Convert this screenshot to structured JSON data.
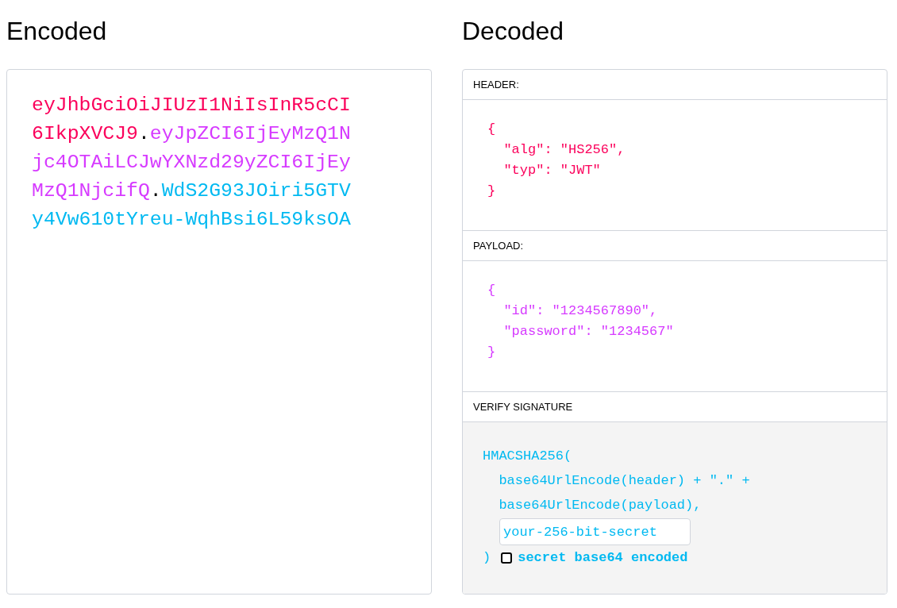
{
  "encoded": {
    "title": "Encoded",
    "segments": [
      {
        "text": "eyJhbGciOiJIUzI1NiIsInR5cCI6IkpXVCJ9",
        "kind": "header"
      },
      {
        "text": ".",
        "kind": "dot"
      },
      {
        "text": "eyJpZCI6IjEyMzQ1Njc4OTAiLCJwYXNzd29yZCI6IjEyMzQ1NjcifQ",
        "kind": "payload"
      },
      {
        "text": ".",
        "kind": "dot"
      },
      {
        "text": "WdS2G93JOiri5GTVy4Vw610tYreu-WqhBsi6L59ksOA",
        "kind": "signature"
      }
    ]
  },
  "decoded": {
    "title": "Decoded",
    "sections": [
      {
        "label": "HEADER:",
        "kind": "header",
        "lines": [
          "{",
          "  \"alg\": \"HS256\",",
          "  \"typ\": \"JWT\"",
          "}"
        ]
      },
      {
        "label": "PAYLOAD:",
        "kind": "payload",
        "lines": [
          "{",
          "  \"id\": \"1234567890\",",
          "  \"password\": \"1234567\"",
          "}"
        ]
      }
    ],
    "verify": {
      "label": "VERIFY SIGNATURE",
      "lines": [
        "HMACSHA256(",
        "  base64UrlEncode(header) + \".\" +",
        "  base64UrlEncode(payload),"
      ],
      "secret": "your-256-bit-secret",
      "closing": ")",
      "checkbox": {
        "label": "secret base64 encoded",
        "checked": false
      }
    }
  }
}
